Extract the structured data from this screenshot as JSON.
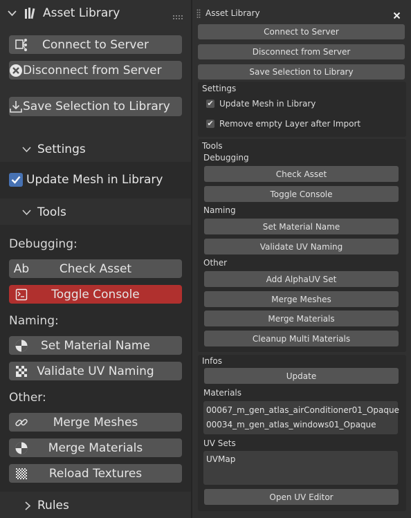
{
  "left": {
    "title": "Asset Library",
    "connect_label": "Connect to Server",
    "disconnect_label": "Disconnect from Server",
    "save_label": "Save Selection to Library",
    "settings_label": "Settings",
    "update_mesh_label": "Update Mesh in Library",
    "update_mesh_checked": true,
    "tools_label": "Tools",
    "debugging_label": "Debugging:",
    "check_asset_label": "Check Asset",
    "toggle_console_label": "Toggle Console",
    "naming_label": "Naming:",
    "set_material_label": "Set Material Name",
    "validate_uv_label": "Validate UV Naming",
    "other_label": "Other:",
    "merge_meshes_label": "Merge Meshes",
    "merge_materials_label": "Merge Materials",
    "reload_textures_label": "Reload Textures",
    "rules_label": "Rules"
  },
  "right": {
    "title": "Asset Library",
    "connect_label": "Connect to Server",
    "disconnect_label": "Disconnect from Server",
    "save_label": "Save Selection to Library",
    "settings_label": "Settings",
    "update_mesh_label": "Update Mesh in Library",
    "remove_layer_label": "Remove empty Layer after Import",
    "tools_label": "Tools",
    "debugging_label": "Debugging",
    "check_asset_label": "Check Asset",
    "toggle_console_label": "Toggle Console",
    "naming_label": "Naming",
    "set_material_label": "Set Material Name",
    "validate_uv_label": "Validate UV Naming",
    "other_label": "Other",
    "add_alpha_label": "Add AlphaUV Set",
    "merge_meshes_label": "Merge Meshes",
    "merge_materials_label": "Merge Materials",
    "cleanup_label": "Cleanup Multi Materials",
    "infos_label": "Infos",
    "update_label": "Update",
    "materials_label": "Materials",
    "materials": [
      "00067_m_gen_atlas_airConditioner01_Opaque",
      "00034_m_gen_atlas_windows01_Opaque"
    ],
    "uvsets_label": "UV Sets",
    "uvsets": [
      "UVMap"
    ],
    "open_uv_label": "Open UV Editor"
  }
}
